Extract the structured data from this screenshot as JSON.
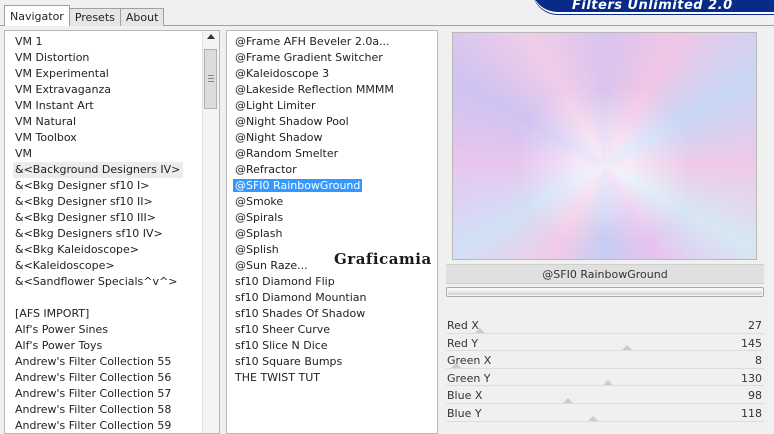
{
  "tabs": [
    {
      "label": "Navigator",
      "active": true
    },
    {
      "label": "Presets",
      "active": false
    },
    {
      "label": "About",
      "active": false
    }
  ],
  "app_title": "Filters Unlimited 2.0",
  "categories": [
    "VM 1",
    "VM Distortion",
    "VM Experimental",
    "VM Extravaganza",
    "VM Instant Art",
    "VM Natural",
    "VM Toolbox",
    "VM",
    "&<Background Designers IV>",
    "&<Bkg Designer sf10 I>",
    "&<Bkg Designer sf10 II>",
    "&<Bkg Designer sf10 III>",
    "&<Bkg Designers sf10 IV>",
    "&<Bkg Kaleidoscope>",
    "&<Kaleidoscope>",
    "&<Sandflower Specials^v^>",
    "",
    "[AFS IMPORT]",
    "Alf's Power Sines",
    "Alf's Power Toys",
    "Andrew's Filter Collection 55",
    "Andrew's Filter Collection 56",
    "Andrew's Filter Collection 57",
    "Andrew's Filter Collection 58",
    "Andrew's Filter Collection 59"
  ],
  "hovered_category_index": 8,
  "filters": [
    "@Frame AFH Beveler 2.0a...",
    "@Frame Gradient Switcher",
    "@Kaleidoscope 3",
    "@Lakeside Reflection MMMM",
    "@Light Limiter",
    "@Night Shadow Pool",
    "@Night Shadow",
    "@Random Smelter",
    "@Refractor",
    "@SFI0 RainbowGround",
    "@Smoke",
    "@Spirals",
    "@Splash",
    "@Splish",
    "@Sun Raze...",
    "sf10 Diamond Flip",
    "sf10 Diamond Mountian",
    "sf10 Shades Of Shadow",
    "sf10 Sheer Curve",
    "sf10 Slice N Dice",
    "sf10 Square Bumps",
    "THE TWIST TUT"
  ],
  "selected_filter_index": 9,
  "watermark": "Graficamia",
  "selected_filter_name": "@SFI0 RainbowGround",
  "sliders": [
    {
      "label": "Red X",
      "value": "27",
      "level": 27
    },
    {
      "label": "Red Y",
      "value": "145",
      "level": 145
    },
    {
      "label": "Green X",
      "value": "8",
      "level": 8
    },
    {
      "label": "Green Y",
      "value": "130",
      "level": 130
    },
    {
      "label": "Blue X",
      "value": "98",
      "level": 98
    },
    {
      "label": "Blue Y",
      "value": "118",
      "level": 118
    }
  ],
  "slider_max": 255,
  "colors": {
    "selection": "#3399ff",
    "logo_background": "#0a2a8a"
  }
}
